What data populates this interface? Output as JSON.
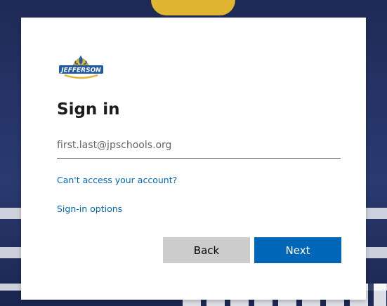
{
  "logo": {
    "text": "JEFFERSON"
  },
  "signin": {
    "title": "Sign in",
    "email_placeholder": "first.last@jpschools.org",
    "email_value": ""
  },
  "links": {
    "cant_access": "Can't access your account?",
    "signin_options": "Sign-in options"
  },
  "buttons": {
    "back": "Back",
    "next": "Next"
  },
  "colors": {
    "accent": "#0067b8",
    "back_button": "#cccccc",
    "logo_blue": "#1f5aa6",
    "logo_gold": "#e0b531"
  }
}
